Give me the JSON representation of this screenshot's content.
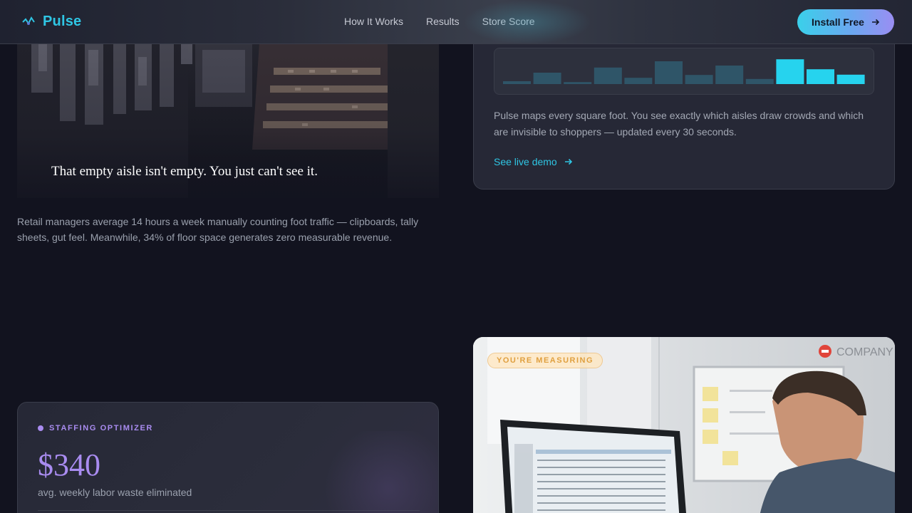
{
  "nav": {
    "brand": "Pulse",
    "links": [
      "How It Works",
      "Results",
      "Store Score"
    ],
    "cta": "Install Free"
  },
  "hero": {
    "caption": "That empty aisle isn't empty. You just can't see it.",
    "body": "Retail managers average 14 hours a week manually counting foot traffic — clipboards, tally sheets, gut feel. Meanwhile, 34% of floor space generates zero measurable revenue."
  },
  "heatmap": {
    "body": "Pulse maps every square foot. You see exactly which aisles draw crowds and which are invisible to shoppers — updated every 30 seconds.",
    "link": "See live demo",
    "bars": [
      0.1,
      0.4,
      0.07,
      0.58,
      0.22,
      0.8,
      0.32,
      0.65,
      0.18,
      0.87,
      0.52,
      0.33
    ],
    "highlight_from": 9
  },
  "staffing": {
    "tag": "STAFFING OPTIMIZER",
    "value": "$340",
    "sub": "avg. weekly labor waste eliminated"
  },
  "office": {
    "badge": "YOU'RE MEASURING",
    "sign": "COMPANY"
  },
  "colors": {
    "accent": "#2fc6e4",
    "purple": "#a98cf0",
    "bg": "#12131f"
  }
}
